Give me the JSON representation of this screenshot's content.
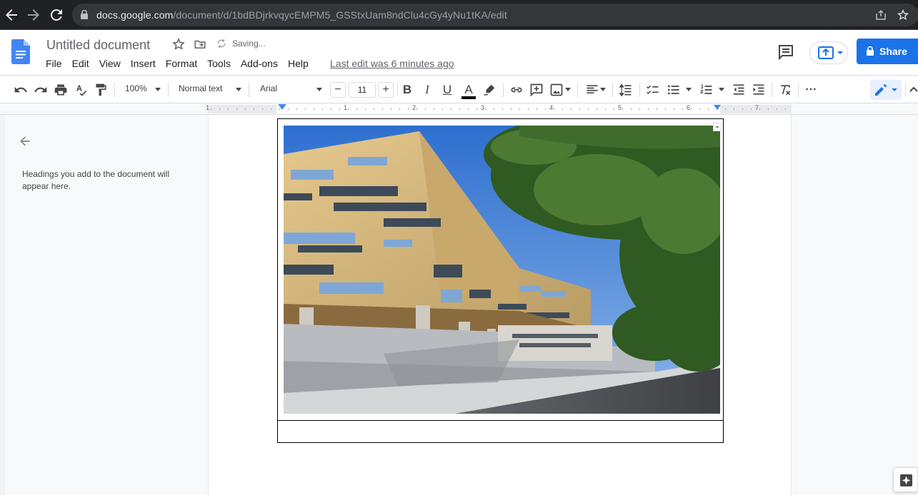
{
  "browser": {
    "url_host": "docs.google.com",
    "url_path": "/document/d/1bdBDjrkvqycEMPM5_GSStxUam8ndClu4cGy4yNu1tKA/edit",
    "icons": [
      "back-arrow-icon",
      "forward-arrow-icon",
      "reload-icon",
      "lock-icon",
      "share-page-icon",
      "bookmark-star-icon"
    ]
  },
  "header": {
    "title": "Untitled document",
    "status": "Saving...",
    "last_edit": "Last edit was 6 minutes ago",
    "share_label": "Share",
    "menu": [
      "File",
      "Edit",
      "View",
      "Insert",
      "Format",
      "Tools",
      "Add-ons",
      "Help"
    ]
  },
  "toolbar": {
    "zoom": "100%",
    "style": "Normal text",
    "font": "Arial",
    "font_size": "11",
    "minus": "−",
    "plus": "+",
    "bold": "B",
    "italic": "I",
    "underline": "U",
    "text_color_letter": "A",
    "more": "⋯"
  },
  "ruler": {
    "labels": [
      "1",
      "1",
      "2",
      "3",
      "4",
      "5",
      "6",
      "7"
    ]
  },
  "outline": {
    "hint": "Headings you add to the document will appear here."
  },
  "colors": {
    "accent": "#1a73e8",
    "browser_bg": "#202124",
    "docs_blue": "#4285f4"
  }
}
